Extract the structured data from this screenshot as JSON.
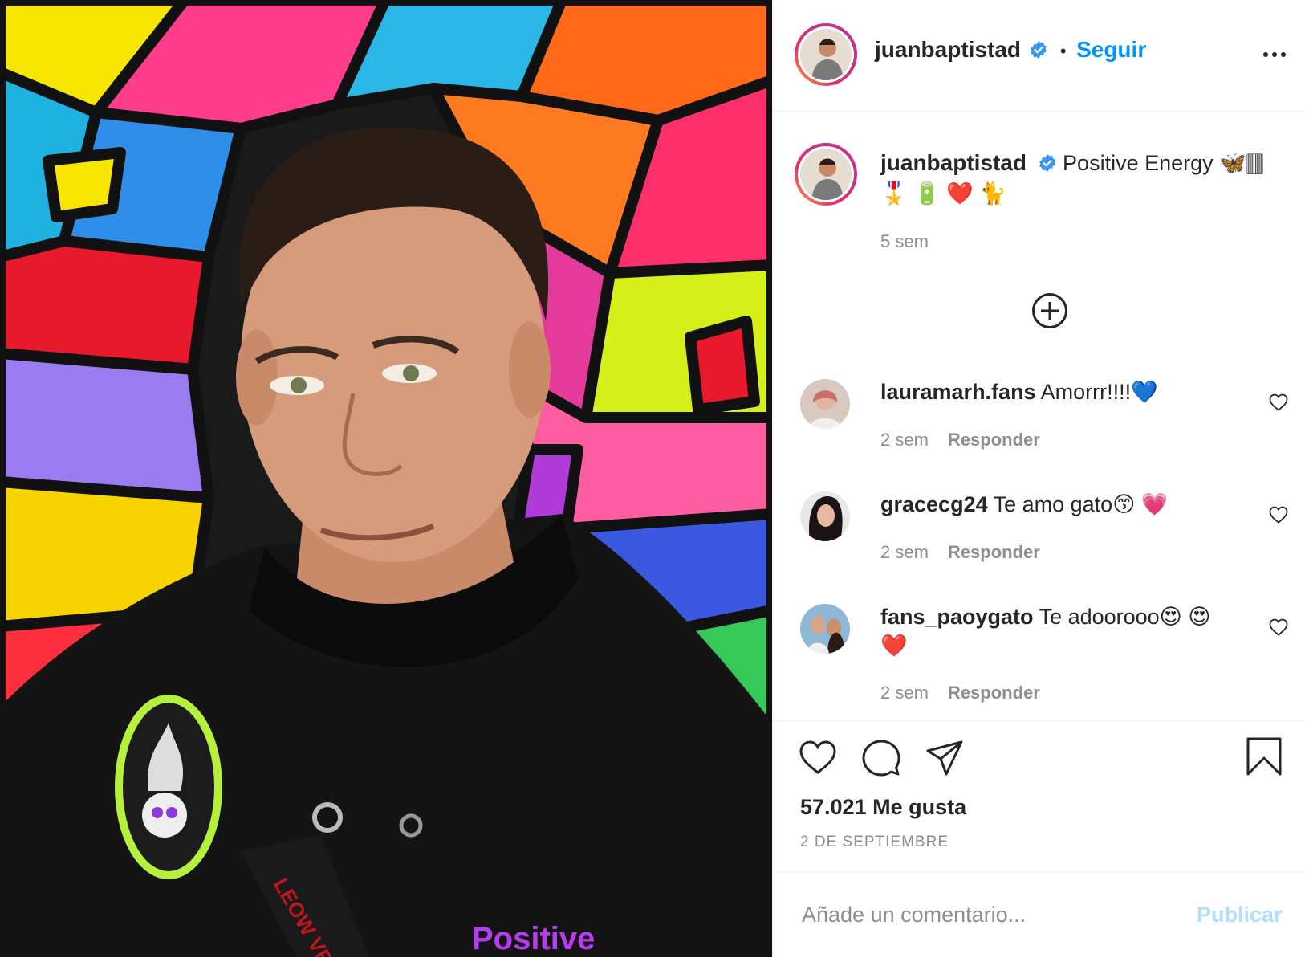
{
  "post": {
    "author": "juanbaptistad",
    "follow_label": "Seguir",
    "dot": "•",
    "caption": "Positive Energy 🦋🀫\n🎖️ 🔋 ❤️ 🐈",
    "caption_age": "5 sem",
    "likes": "57.021 Me gusta",
    "date": "2 DE SEPTIEMBRE",
    "shirt_text": "Positive"
  },
  "comments": [
    {
      "user": "lauramarh.fans",
      "text": "Amorrr!!!!💙",
      "age": "2 sem",
      "reply": "Responder"
    },
    {
      "user": "gracecg24",
      "text": "Te amo gato😙 💗",
      "age": "2 sem",
      "reply": "Responder"
    },
    {
      "user": "fans_paoygato",
      "text": "Te adoorooo😍 😍 ❤️",
      "age": "2 sem",
      "reply": "Responder"
    }
  ],
  "composer": {
    "placeholder": "Añade un comentario...",
    "publish_label": "Publicar"
  },
  "colors": {
    "link_blue": "#0095f6",
    "publish_disabled": "#b2dffc",
    "muted": "#8e8e8e",
    "verified_blue": "#3897f0"
  },
  "icons": [
    "more-icon",
    "verified-icon",
    "add-comments-icon",
    "heart-icon",
    "comment-icon",
    "share-icon",
    "bookmark-icon"
  ]
}
